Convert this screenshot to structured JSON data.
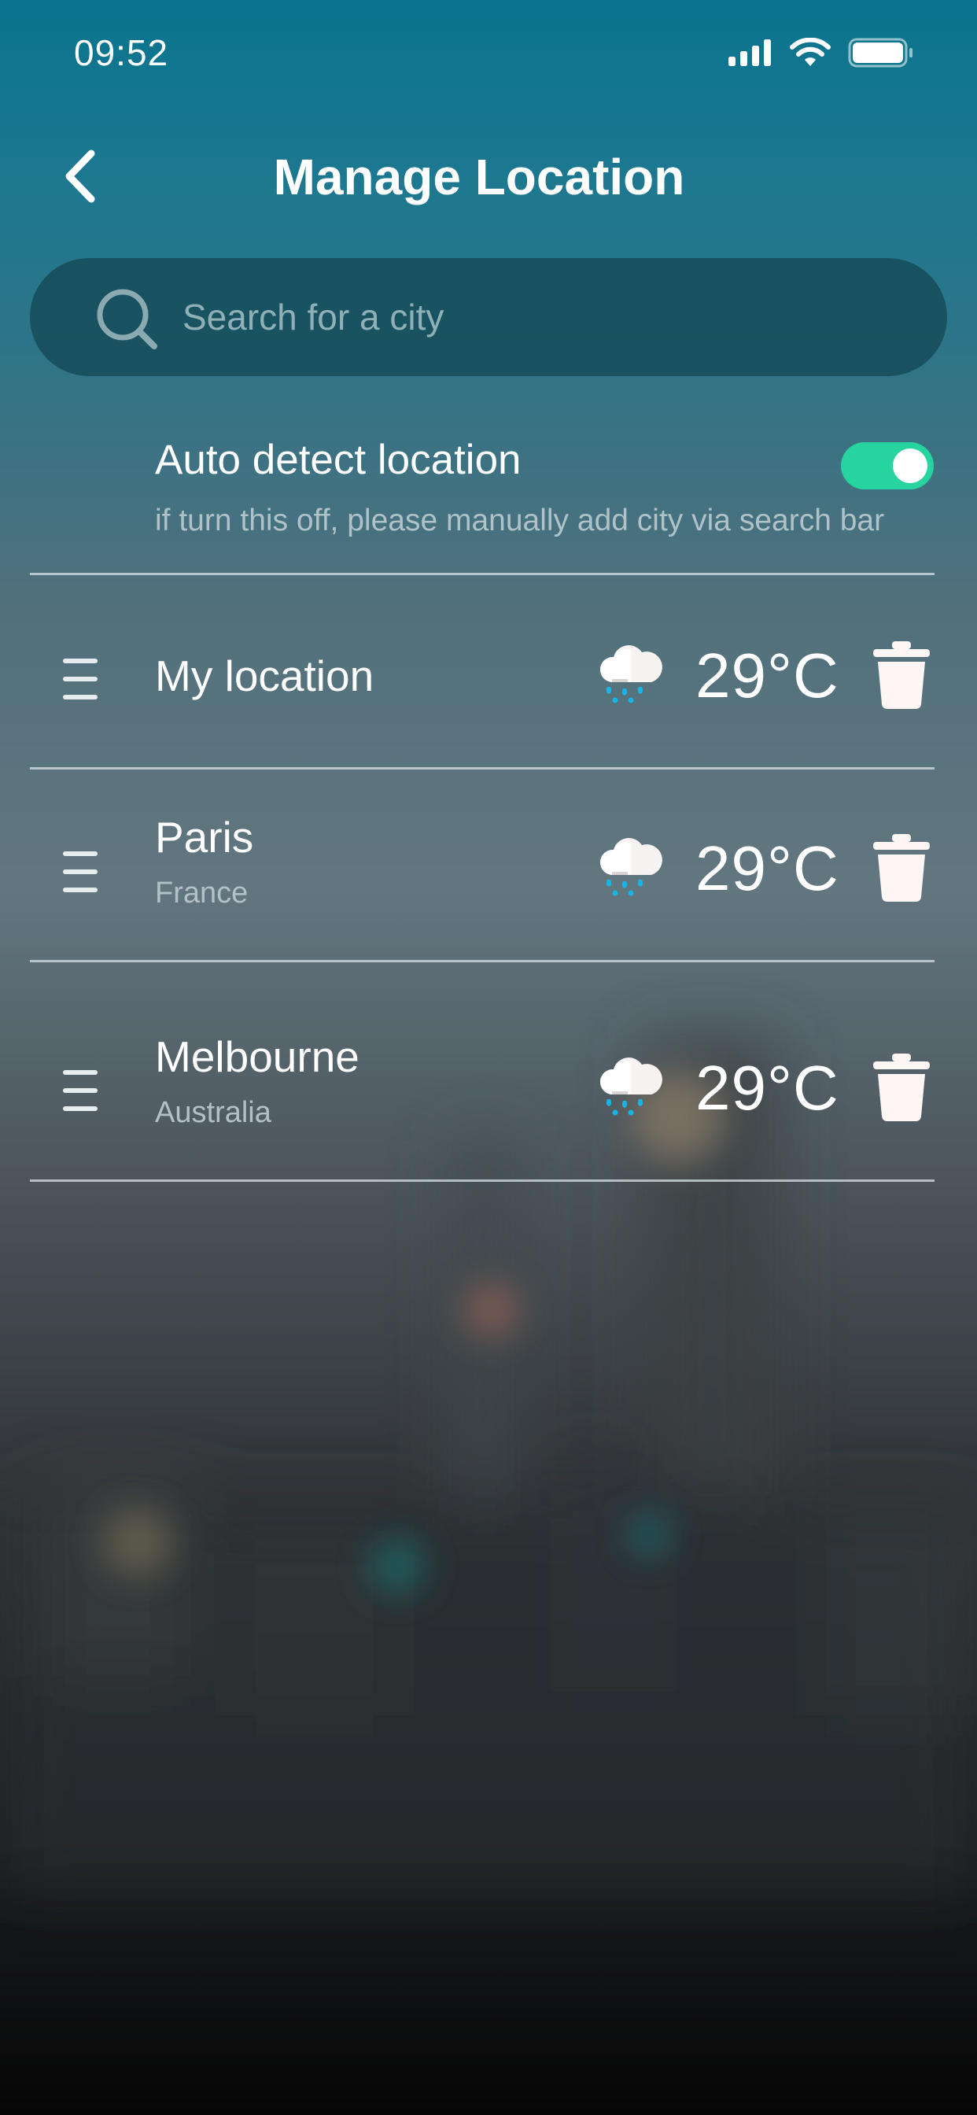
{
  "status_bar": {
    "time": "09:52",
    "icons": [
      "signal-icon",
      "wifi-icon",
      "battery-icon"
    ]
  },
  "header": {
    "title": "Manage Location",
    "back_icon": "chevron-left-icon"
  },
  "search": {
    "placeholder": "Search for a city",
    "value": "",
    "icon": "search-icon"
  },
  "auto_detect": {
    "title": "Auto detect location",
    "subtitle": "if turn this off, please manually add city via search bar",
    "enabled": true,
    "toggle_color": "#27d4a0"
  },
  "locations": [
    {
      "name": "My location",
      "country": "",
      "temperature": "29°C",
      "weather_icon": "rain-cloud-icon"
    },
    {
      "name": "Paris",
      "country": "France",
      "temperature": "29°C",
      "weather_icon": "rain-cloud-icon"
    },
    {
      "name": "Melbourne",
      "country": "Australia",
      "temperature": "29°C",
      "weather_icon": "rain-cloud-icon"
    }
  ],
  "colors": {
    "accent": "#27d4a0",
    "background_top": "#0a748e",
    "background_bottom": "#060606",
    "rain_drop": "#18b4e8"
  }
}
